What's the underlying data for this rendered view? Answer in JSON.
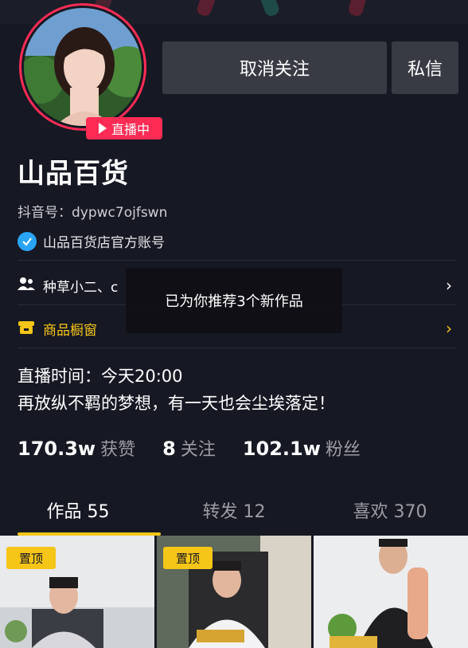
{
  "profile": {
    "name": "山品百货",
    "douyin_id": "抖音号：dypwc7ojfswn",
    "verified_text": "山品百货店官方账号",
    "live_badge": "直播中"
  },
  "actions": {
    "unfollow_label": "取消关注",
    "dm_label": "私信"
  },
  "rows": {
    "friends_label": "种草小二、c",
    "shop_label": "商品橱窗"
  },
  "toast": {
    "text": "已为你推荐3个新作品"
  },
  "bio": {
    "line1": "直播时间：今天20:00",
    "line2": "再放纵不羁的梦想，有一天也会尘埃落定！"
  },
  "stats": [
    {
      "num": "170.3w",
      "label": "获赞"
    },
    {
      "num": "8",
      "label": "关注"
    },
    {
      "num": "102.1w",
      "label": "粉丝"
    }
  ],
  "tabs": [
    {
      "label": "作品 55"
    },
    {
      "label": "转发 12"
    },
    {
      "label": "喜欢 370"
    }
  ],
  "videos": [
    {
      "pin": "置顶"
    },
    {
      "pin": "置顶"
    },
    {
      "pin": ""
    }
  ],
  "colors": {
    "background": "#161823",
    "accent_red": "#fe2c55",
    "accent_yellow": "#f5c518",
    "verified_blue": "#2aa4f4",
    "button_bg": "#393b44"
  }
}
